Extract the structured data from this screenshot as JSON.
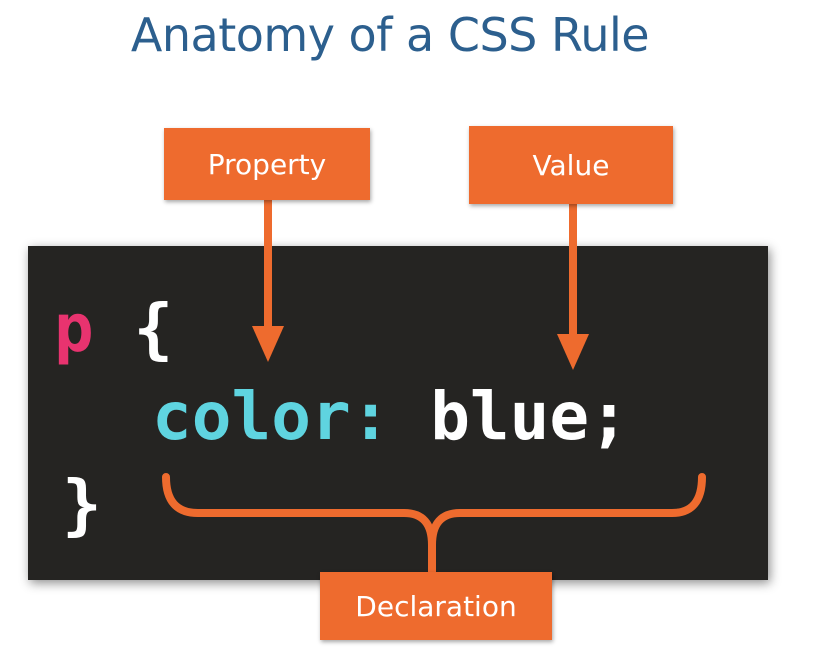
{
  "title": "Anatomy of a CSS Rule",
  "labels": {
    "property": "Property",
    "value": "Value",
    "declaration": "Declaration"
  },
  "code": {
    "selector": "p",
    "open_brace": "{",
    "property": "color",
    "colon": ":",
    "value": "blue",
    "semicolon": ";",
    "close_brace": "}"
  },
  "colors": {
    "title": "#2c5f8e",
    "callout": "#ee6b2e",
    "panel": "#252422",
    "selector": "#e8336f",
    "property": "#5fd4e0",
    "value": "#ffffff"
  }
}
